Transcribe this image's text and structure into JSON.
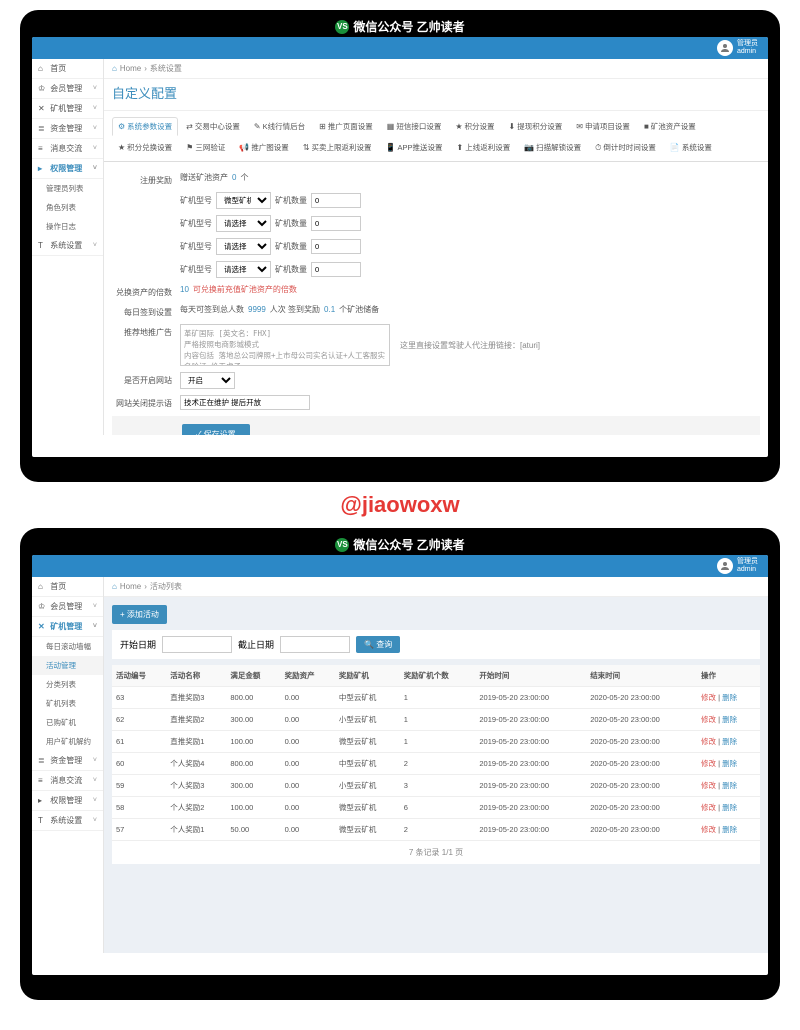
{
  "brand_bar": {
    "badge": "VS",
    "text": "微信公众号 乙帅读者"
  },
  "header": {
    "role": "管理员",
    "user": "admin"
  },
  "watermark": "@jiaowoxw",
  "screen1": {
    "breadcrumb": {
      "home": "Home",
      "current": "系统设置"
    },
    "page_title": "自定义配置",
    "sidebar": {
      "items": [
        {
          "label": "首页",
          "icon": "⌂"
        },
        {
          "label": "会员管理",
          "icon": "♔",
          "expand": true
        },
        {
          "label": "矿机管理",
          "icon": "✕",
          "expand": true
        },
        {
          "label": "资金管理",
          "icon": "≣",
          "expand": true
        },
        {
          "label": "消息交流",
          "icon": "≡",
          "expand": true
        },
        {
          "label": "权限管理",
          "icon": "▸",
          "expand": true,
          "active": true
        },
        {
          "label": "系统设置",
          "icon": "T",
          "expand": true
        }
      ],
      "subs": [
        "管理员列表",
        "角色列表",
        "操作日志"
      ]
    },
    "tabs": [
      {
        "icon": "⚙",
        "label": "系统参数设置",
        "active": true
      },
      {
        "icon": "⇄",
        "label": "交易中心设置"
      },
      {
        "icon": "✎",
        "label": "K线行情后台"
      },
      {
        "icon": "⊞",
        "label": "推广页面设置"
      },
      {
        "icon": "▦",
        "label": "短信接口设置"
      },
      {
        "icon": "★",
        "label": "积分设置"
      },
      {
        "icon": "⬇",
        "label": "提现积分设置"
      },
      {
        "icon": "✉",
        "label": "申请项目设置"
      },
      {
        "icon": "■",
        "label": "矿池资产设置"
      },
      {
        "icon": "★",
        "label": "积分兑换设置"
      },
      {
        "icon": "⚑",
        "label": "三网验证"
      },
      {
        "icon": "📢",
        "label": "推广图设置"
      },
      {
        "icon": "⇅",
        "label": "买卖上限返利设置"
      },
      {
        "icon": "📱",
        "label": "APP推送设置"
      },
      {
        "icon": "⬆",
        "label": "上线返利设置"
      },
      {
        "icon": "📷",
        "label": "扫描解锁设置"
      },
      {
        "icon": "⏱",
        "label": "倒计时时间设置"
      },
      {
        "icon": "📄",
        "label": "系统设置"
      }
    ],
    "form": {
      "reg_reward_label": "注册奖励",
      "reg_reward_text": "赠送矿池资产",
      "reg_reward_value": "0",
      "reg_reward_unit": "个",
      "miner_rows": [
        {
          "type_label": "矿机型号",
          "type_value": "微型矿机",
          "qty_label": "矿机数量",
          "qty_value": "0"
        },
        {
          "type_label": "矿机型号",
          "type_value": "请选择",
          "qty_label": "矿机数量",
          "qty_value": "0"
        },
        {
          "type_label": "矿机型号",
          "type_value": "请选择",
          "qty_label": "矿机数量",
          "qty_value": "0"
        },
        {
          "type_label": "矿机型号",
          "type_value": "请选择",
          "qty_label": "矿机数量",
          "qty_value": "0"
        }
      ],
      "exchange_label": "兑换资产的倍数",
      "exchange_value": "10",
      "exchange_hint": "可兑换前充值矿池资产的倍数",
      "daily_label": "每日签到设置",
      "daily_text1": "每天可签到总人数",
      "daily_value1": "9999",
      "daily_unit1": "人次",
      "daily_text2": "签到奖励",
      "daily_value2": "0.1",
      "daily_unit2": "个矿池储备",
      "promo_label": "推荐地推广告",
      "promo_placeholder": "革矿国际 [英文名：FHX]\n严格按照电商影城模式\n内容包括 落地总公司牌照+上市母公司实名认证+人工客服实名验证 绝无虚子\n怎有底子做不了的没没方案长久项目",
      "promo_hint": "这里直接设置驾驶人代注册链接：[aturi]",
      "enable_label": "是否开启网站",
      "enable_value": "开启",
      "close_label": "网站关闭提示语",
      "close_placeholder": "技术正在维护 提后开放",
      "save_btn": "保存设置"
    }
  },
  "screen2": {
    "breadcrumb": {
      "home": "Home",
      "current": "活动列表"
    },
    "sidebar": {
      "items": [
        {
          "label": "首页",
          "icon": "⌂"
        },
        {
          "label": "会员管理",
          "icon": "♔",
          "expand": true
        },
        {
          "label": "矿机管理",
          "icon": "✕",
          "expand": true,
          "active": true
        },
        {
          "label": "资金管理",
          "icon": "≣",
          "expand": true
        },
        {
          "label": "消息交流",
          "icon": "≡",
          "expand": true
        },
        {
          "label": "权限管理",
          "icon": "▸",
          "expand": true
        },
        {
          "label": "系统设置",
          "icon": "T",
          "expand": true
        }
      ],
      "subs": [
        "每日滚动墙幅",
        "活动管理",
        "分类列表",
        "矿机列表",
        "已购矿机",
        "用户矿机解约"
      ]
    },
    "add_btn": "+ 添加活动",
    "filter": {
      "start_label": "开始日期",
      "end_label": "截止日期",
      "search": "🔍 查询"
    },
    "table": {
      "headers": [
        "活动编号",
        "活动名称",
        "满足金额",
        "奖励资产",
        "奖励矿机",
        "奖励矿机个数",
        "开始时间",
        "结束时间",
        "操作"
      ],
      "rows": [
        [
          "63",
          "直推奖励3",
          "800.00",
          "0.00",
          "中型云矿机",
          "1",
          "2019-05-20 23:00:00",
          "2020-05-20 23:00:00"
        ],
        [
          "62",
          "直推奖励2",
          "300.00",
          "0.00",
          "小型云矿机",
          "1",
          "2019-05-20 23:00:00",
          "2020-05-20 23:00:00"
        ],
        [
          "61",
          "直推奖励1",
          "100.00",
          "0.00",
          "微型云矿机",
          "1",
          "2019-05-20 23:00:00",
          "2020-05-20 23:00:00"
        ],
        [
          "60",
          "个人奖励4",
          "800.00",
          "0.00",
          "中型云矿机",
          "2",
          "2019-05-20 23:00:00",
          "2020-05-20 23:00:00"
        ],
        [
          "59",
          "个人奖励3",
          "300.00",
          "0.00",
          "小型云矿机",
          "3",
          "2019-05-20 23:00:00",
          "2020-05-20 23:00:00"
        ],
        [
          "58",
          "个人奖励2",
          "100.00",
          "0.00",
          "微型云矿机",
          "6",
          "2019-05-20 23:00:00",
          "2020-05-20 23:00:00"
        ],
        [
          "57",
          "个人奖励1",
          "50.00",
          "0.00",
          "微型云矿机",
          "2",
          "2019-05-20 23:00:00",
          "2020-05-20 23:00:00"
        ]
      ],
      "op_edit": "修改",
      "op_del": "删除",
      "pagination": "7 条记录 1/1 页"
    }
  }
}
